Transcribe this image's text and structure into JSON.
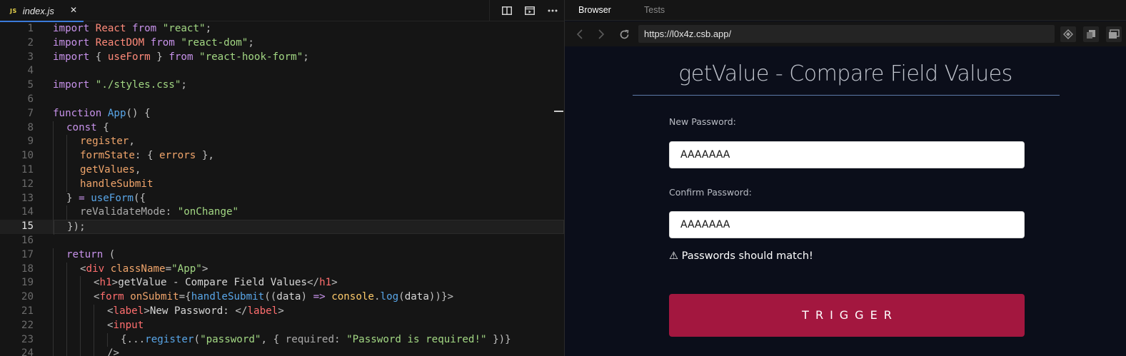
{
  "editor": {
    "tab": {
      "icon_text": "JS",
      "filename": "index.js",
      "close": "✕"
    },
    "toolbar": {
      "split_icon": "split-editor-icon",
      "preview_icon": "preview-icon",
      "more_icon": "more-icon"
    },
    "lines": [
      {
        "n": "1",
        "indent": 0,
        "tokens": [
          [
            "kw",
            "import "
          ],
          [
            "ident",
            "React "
          ],
          [
            "kw",
            "from "
          ],
          [
            "str",
            "\"react\""
          ],
          [
            "punct",
            ";"
          ]
        ]
      },
      {
        "n": "2",
        "indent": 0,
        "tokens": [
          [
            "kw",
            "import "
          ],
          [
            "ident",
            "ReactDOM "
          ],
          [
            "kw",
            "from "
          ],
          [
            "str",
            "\"react-dom\""
          ],
          [
            "punct",
            ";"
          ]
        ]
      },
      {
        "n": "3",
        "indent": 0,
        "tokens": [
          [
            "kw",
            "import "
          ],
          [
            "punct",
            "{ "
          ],
          [
            "ident",
            "useForm "
          ],
          [
            "punct",
            "} "
          ],
          [
            "kw",
            "from "
          ],
          [
            "str",
            "\"react-hook-form\""
          ],
          [
            "punct",
            ";"
          ]
        ]
      },
      {
        "n": "4",
        "indent": 0,
        "tokens": []
      },
      {
        "n": "5",
        "indent": 0,
        "tokens": [
          [
            "kw",
            "import "
          ],
          [
            "str",
            "\"./styles.css\""
          ],
          [
            "punct",
            ";"
          ]
        ]
      },
      {
        "n": "6",
        "indent": 0,
        "tokens": []
      },
      {
        "n": "7",
        "indent": 0,
        "tokens": [
          [
            "kw",
            "function "
          ],
          [
            "fn",
            "App"
          ],
          [
            "punct",
            "() {"
          ]
        ]
      },
      {
        "n": "8",
        "indent": 1,
        "tokens": [
          [
            "kw",
            "const "
          ],
          [
            "punct",
            "{"
          ]
        ]
      },
      {
        "n": "9",
        "indent": 2,
        "tokens": [
          [
            "prop",
            "register"
          ],
          [
            "punct",
            ","
          ]
        ]
      },
      {
        "n": "10",
        "indent": 2,
        "tokens": [
          [
            "prop",
            "formState"
          ],
          [
            "punct",
            ": { "
          ],
          [
            "prop",
            "errors "
          ],
          [
            "punct",
            "},"
          ]
        ]
      },
      {
        "n": "11",
        "indent": 2,
        "tokens": [
          [
            "prop",
            "getValues"
          ],
          [
            "punct",
            ","
          ]
        ]
      },
      {
        "n": "12",
        "indent": 2,
        "tokens": [
          [
            "prop",
            "handleSubmit"
          ]
        ]
      },
      {
        "n": "13",
        "indent": 1,
        "tokens": [
          [
            "punct",
            "} "
          ],
          [
            "op",
            "= "
          ],
          [
            "fn",
            "useForm"
          ],
          [
            "punct",
            "({"
          ]
        ]
      },
      {
        "n": "14",
        "indent": 2,
        "tokens": [
          [
            "dim",
            "reValidateMode"
          ],
          [
            "punct",
            ": "
          ],
          [
            "str",
            "\"onChange\""
          ]
        ]
      },
      {
        "n": "15",
        "indent": 1,
        "active": true,
        "tokens": [
          [
            "punct",
            "});"
          ]
        ]
      },
      {
        "n": "16",
        "indent": 0,
        "tokens": []
      },
      {
        "n": "17",
        "indent": 1,
        "tokens": [
          [
            "kw",
            "return "
          ],
          [
            "punct",
            "("
          ]
        ]
      },
      {
        "n": "18",
        "indent": 2,
        "tokens": [
          [
            "punct",
            "<"
          ],
          [
            "tag",
            "div "
          ],
          [
            "attr",
            "className"
          ],
          [
            "punct",
            "="
          ],
          [
            "str",
            "\"App\""
          ],
          [
            "punct",
            ">"
          ]
        ]
      },
      {
        "n": "19",
        "indent": 3,
        "tokens": [
          [
            "punct",
            "<"
          ],
          [
            "tag",
            "h1"
          ],
          [
            "punct",
            ">"
          ],
          [
            "plain",
            "getValue - Compare Field Values"
          ],
          [
            "punct",
            "</"
          ],
          [
            "tag",
            "h1"
          ],
          [
            "punct",
            ">"
          ]
        ]
      },
      {
        "n": "20",
        "indent": 3,
        "tokens": [
          [
            "punct",
            "<"
          ],
          [
            "tag",
            "form "
          ],
          [
            "attr",
            "onSubmit"
          ],
          [
            "punct",
            "={"
          ],
          [
            "fn",
            "handleSubmit"
          ],
          [
            "punct",
            "(("
          ],
          [
            "plain",
            "data"
          ],
          [
            "punct",
            ") "
          ],
          [
            "op",
            "=> "
          ],
          [
            "obj",
            "console"
          ],
          [
            "punct",
            "."
          ],
          [
            "fn",
            "log"
          ],
          [
            "punct",
            "("
          ],
          [
            "plain",
            "data"
          ],
          [
            "punct",
            "))}>"
          ]
        ]
      },
      {
        "n": "21",
        "indent": 4,
        "tokens": [
          [
            "punct",
            "<"
          ],
          [
            "tag",
            "label"
          ],
          [
            "punct",
            ">"
          ],
          [
            "plain",
            "New Password: "
          ],
          [
            "punct",
            "</"
          ],
          [
            "tag",
            "label"
          ],
          [
            "punct",
            ">"
          ]
        ]
      },
      {
        "n": "22",
        "indent": 4,
        "tokens": [
          [
            "punct",
            "<"
          ],
          [
            "tag",
            "input"
          ]
        ]
      },
      {
        "n": "23",
        "indent": 5,
        "tokens": [
          [
            "punct",
            "{..."
          ],
          [
            "fn",
            "register"
          ],
          [
            "punct",
            "("
          ],
          [
            "str",
            "\"password\""
          ],
          [
            "punct",
            ", { "
          ],
          [
            "dim",
            "required"
          ],
          [
            "punct",
            ": "
          ],
          [
            "str",
            "\"Password is required!\""
          ],
          [
            "punct",
            " })}"
          ]
        ]
      },
      {
        "n": "24",
        "indent": 4,
        "tokens": [
          [
            "punct",
            "/>"
          ]
        ]
      }
    ]
  },
  "browser": {
    "tabs": {
      "browser": "Browser",
      "tests": "Tests"
    },
    "url": "https://l0x4z.csb.app/",
    "nav": {
      "back_icon": "back-icon",
      "forward_icon": "forward-icon",
      "refresh_icon": "refresh-icon"
    },
    "page": {
      "title": "getValue - Compare Field Values",
      "new_password_label": "New Password:",
      "new_password_value": "AAAAAAA",
      "confirm_password_label": "Confirm Password:",
      "confirm_password_value": "AAAAAAA",
      "error": "⚠ Passwords should match!",
      "trigger": "TRIGGER"
    }
  },
  "colors": {
    "accent": "#3b7ad9",
    "button": "#a3173f",
    "page_bg": "#0b0e1a",
    "editor_bg": "#151515"
  }
}
